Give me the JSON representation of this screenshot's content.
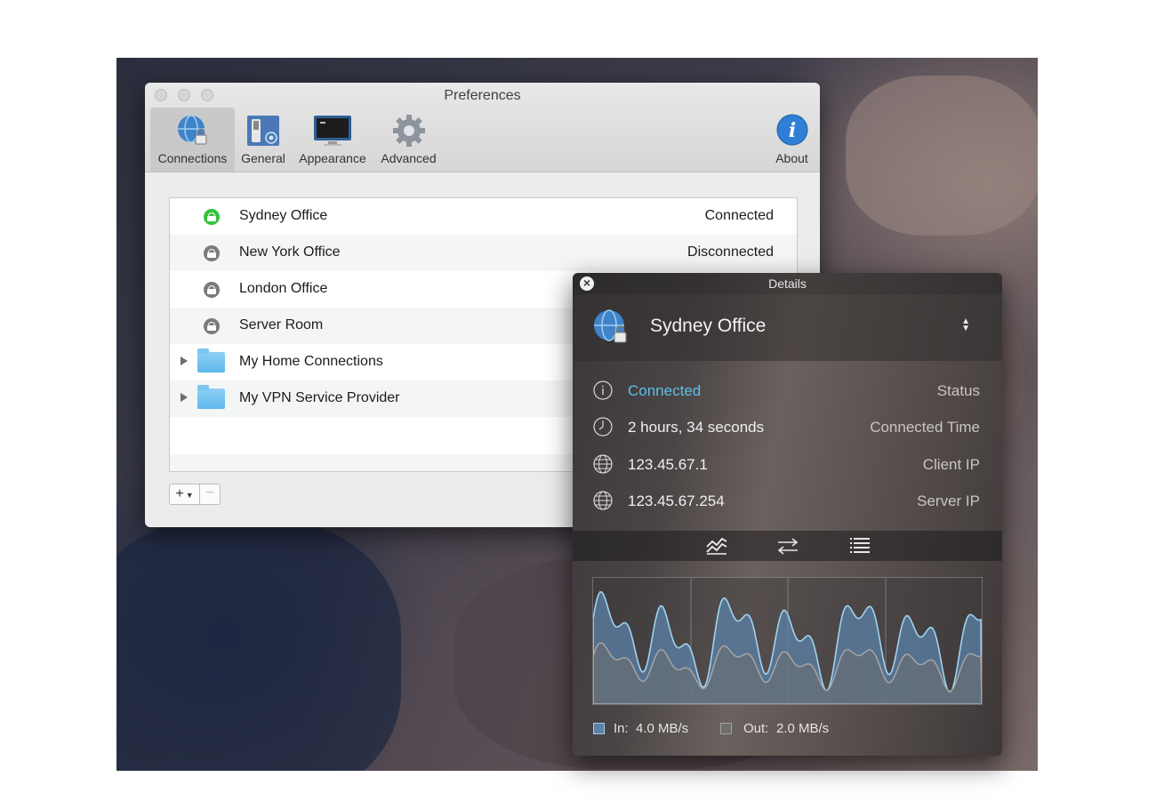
{
  "preferences": {
    "title": "Preferences",
    "toolbar": [
      {
        "label": "Connections",
        "icon": "globe-lock-icon"
      },
      {
        "label": "General",
        "icon": "switch-icon"
      },
      {
        "label": "Appearance",
        "icon": "display-icon"
      },
      {
        "label": "Advanced",
        "icon": "gear-icon"
      },
      {
        "label": "About",
        "icon": "info-icon"
      }
    ],
    "connections": [
      {
        "name": "Sydney Office",
        "state": "Connected",
        "type": "vpn",
        "status_color": "#34c23b"
      },
      {
        "name": "New York Office",
        "state": "Disconnected",
        "type": "vpn",
        "status_color": "#7b7b7b"
      },
      {
        "name": "London Office",
        "state": "",
        "type": "vpn",
        "status_color": "#7b7b7b"
      },
      {
        "name": "Server Room",
        "state": "",
        "type": "vpn",
        "status_color": "#7b7b7b"
      },
      {
        "name": "My Home Connections",
        "state": "",
        "type": "folder"
      },
      {
        "name": "My VPN Service Provider",
        "state": "",
        "type": "folder"
      }
    ],
    "add_label": "+",
    "remove_label": "−"
  },
  "details": {
    "title": "Details",
    "connection_name": "Sydney Office",
    "rows": [
      {
        "value": "Connected",
        "label": "Status",
        "icon": "info-icon"
      },
      {
        "value": "2 hours, 34 seconds",
        "label": "Connected Time",
        "icon": "clock-icon"
      },
      {
        "value": "123.45.67.1",
        "label": "Client IP",
        "icon": "globe-icon"
      },
      {
        "value": "123.45.67.254",
        "label": "Server IP",
        "icon": "globe-icon"
      }
    ],
    "tabs": [
      "graph-tab",
      "transfer-tab",
      "log-tab"
    ],
    "traffic": {
      "in_label": "In:",
      "in_value": "4.0 MB/s",
      "in_color": "#5b82a8",
      "out_label": "Out:",
      "out_value": "2.0 MB/s",
      "out_color": "#6e6e6e"
    }
  },
  "accent_color": "#5cc0ea"
}
